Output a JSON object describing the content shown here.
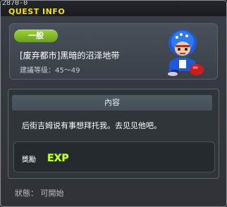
{
  "window": {
    "id": "2870-0",
    "title": "QUEST INFO"
  },
  "quest": {
    "category_badge": "一般",
    "name": "[废弃都市]黑暗的沼泽地带",
    "level_range": "建議等级：45～49"
  },
  "content": {
    "header": "內容",
    "description": "后街吉姆说有事想拜托我。去见见他吧。"
  },
  "reward": {
    "label": "獎勵",
    "exp_icon_text": "EXP"
  },
  "status": {
    "text": "狀態： 可開始"
  },
  "colors": {
    "title_yellow": "#f2e200",
    "badge_green": "#8cc63f",
    "panel_dark": "#30353a"
  }
}
